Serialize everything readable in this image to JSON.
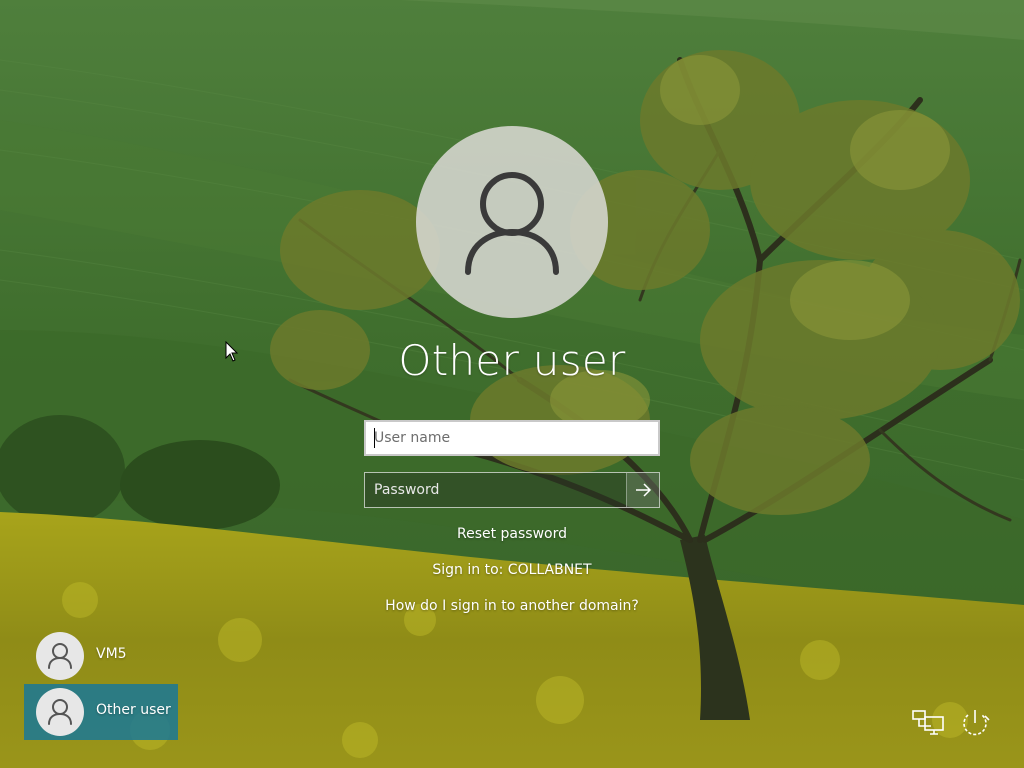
{
  "login": {
    "title": "Other user",
    "username_placeholder": "User name",
    "username_value": "",
    "password_placeholder": "Password",
    "password_value": "",
    "reset_link": "Reset password",
    "sign_in_to": "Sign in to: COLLABNET",
    "domain_help_link": "How do I sign in to another domain?"
  },
  "users": [
    {
      "label": "VM5",
      "icon": "user-avatar-icon",
      "selected": false
    },
    {
      "label": "Other user",
      "icon": "user-avatar-icon",
      "selected": true
    }
  ],
  "tray": {
    "network_icon": "network-icon",
    "power_icon": "power-icon"
  },
  "colors": {
    "selected_tile": "#1a7896",
    "field_background": "#ffffff",
    "text": "#ffffff"
  }
}
